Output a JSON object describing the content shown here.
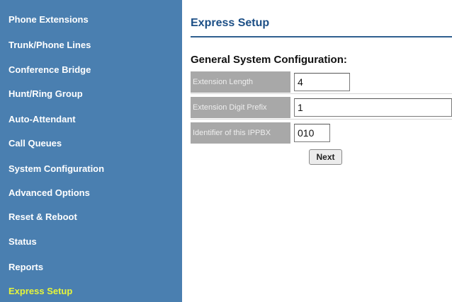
{
  "sidebar": {
    "items": [
      {
        "label": "Phone Extensions"
      },
      {
        "label": "Trunk/Phone Lines"
      },
      {
        "label": "Conference Bridge"
      },
      {
        "label": "Hunt/Ring Group"
      },
      {
        "label": "Auto-Attendant"
      },
      {
        "label": "Call Queues"
      },
      {
        "label": "System Configuration"
      },
      {
        "label": "Advanced Options"
      },
      {
        "label": "Reset & Reboot"
      },
      {
        "label": "Status"
      },
      {
        "label": "Reports"
      },
      {
        "label": "Express Setup",
        "active": true
      }
    ]
  },
  "main": {
    "title": "Express Setup",
    "section_title": "General System Configuration:",
    "fields": [
      {
        "label": "Extension Length",
        "value": "4"
      },
      {
        "label": "Extension Digit Prefix",
        "value": "1"
      },
      {
        "label": "Identifier of this IPPBX",
        "value": "010"
      }
    ],
    "next_label": "Next"
  },
  "colors": {
    "sidebar_bg": "#4a7fb0",
    "active_item": "#e6f53a",
    "title": "#1c4f86",
    "label_bg": "#a8a8a8"
  }
}
